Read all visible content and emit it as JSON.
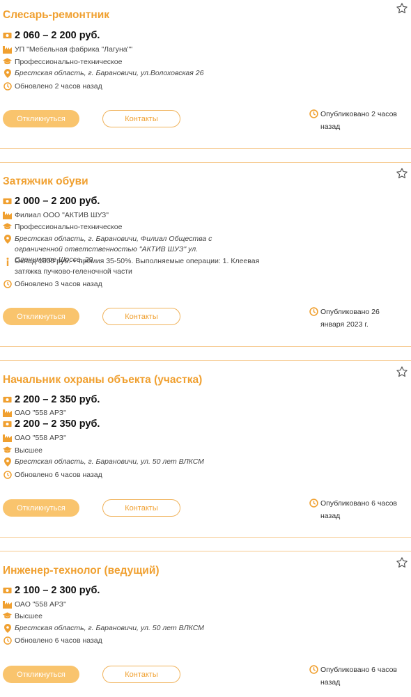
{
  "icons": {
    "salary": "money-icon",
    "company": "factory-icon",
    "education": "graduation-cap-icon",
    "address": "location-pin-icon",
    "info": "info-icon",
    "updated": "clock-icon",
    "favorite": "star-icon"
  },
  "colors": {
    "accent": "#f0a030",
    "button_fill": "#f9c46d",
    "divider": "#f6c88c"
  },
  "apply_label": "Откликнуться",
  "contacts_label": "Контакты",
  "vacancies": [
    {
      "title": "Слесарь-ремонтник",
      "salary": "2 060 – 2 200 руб.",
      "company": "УП \"Мебельная фабрика \"Лагуна\"\"",
      "education": "Профессионально-техническое",
      "address": "Брестская область, г. Барановичи, ул.Волоховская 26",
      "updated": "Обновлено 2 часов назад",
      "published": "Опубликовано 2 часов назад"
    },
    {
      "title": "Затяжчик обуви",
      "salary": "2 000 – 2 200 руб.",
      "company": "Филиал ООО \"АКТИВ ШУЗ\"",
      "education": "Профессионально-техническое",
      "address": "Брестская область, г. Барановичи, Филиал Общества с ограниченной ответственностью \"АКТИВ ШУЗ\" ул. Слонимское Шоссе, 29",
      "info": "Оклад 1500 руб. + премия 35-50%. Выполняемые операции: 1. Клеевая затяжка пучково-геленочной части",
      "updated": "Обновлено 3 часов назад",
      "published": "Опубликовано 26 января 2023 г."
    },
    {
      "title": "Начальник охраны объекта (участка)",
      "salary": "2 200 – 2 350 руб.",
      "company": "ОАО \"558 АРЗ\"",
      "salary2": "2 200 – 2 350 руб.",
      "company2": "ОАО \"558 АРЗ\"",
      "education": "Высшее",
      "address": "Брестская область, г. Барановичи, ул. 50 лет ВЛКСМ",
      "updated": "Обновлено 6 часов назад",
      "published": "Опубликовано 6 часов назад"
    },
    {
      "title": "Инженер-технолог (ведущий)",
      "salary": "2 100 – 2 300 руб.",
      "company": "ОАО \"558 АРЗ\"",
      "education": "Высшее",
      "address": "Брестская область, г. Барановичи, ул. 50 лет ВЛКСМ",
      "updated": "Обновлено 6 часов назад",
      "published": "Опубликовано 6 часов назад"
    }
  ]
}
